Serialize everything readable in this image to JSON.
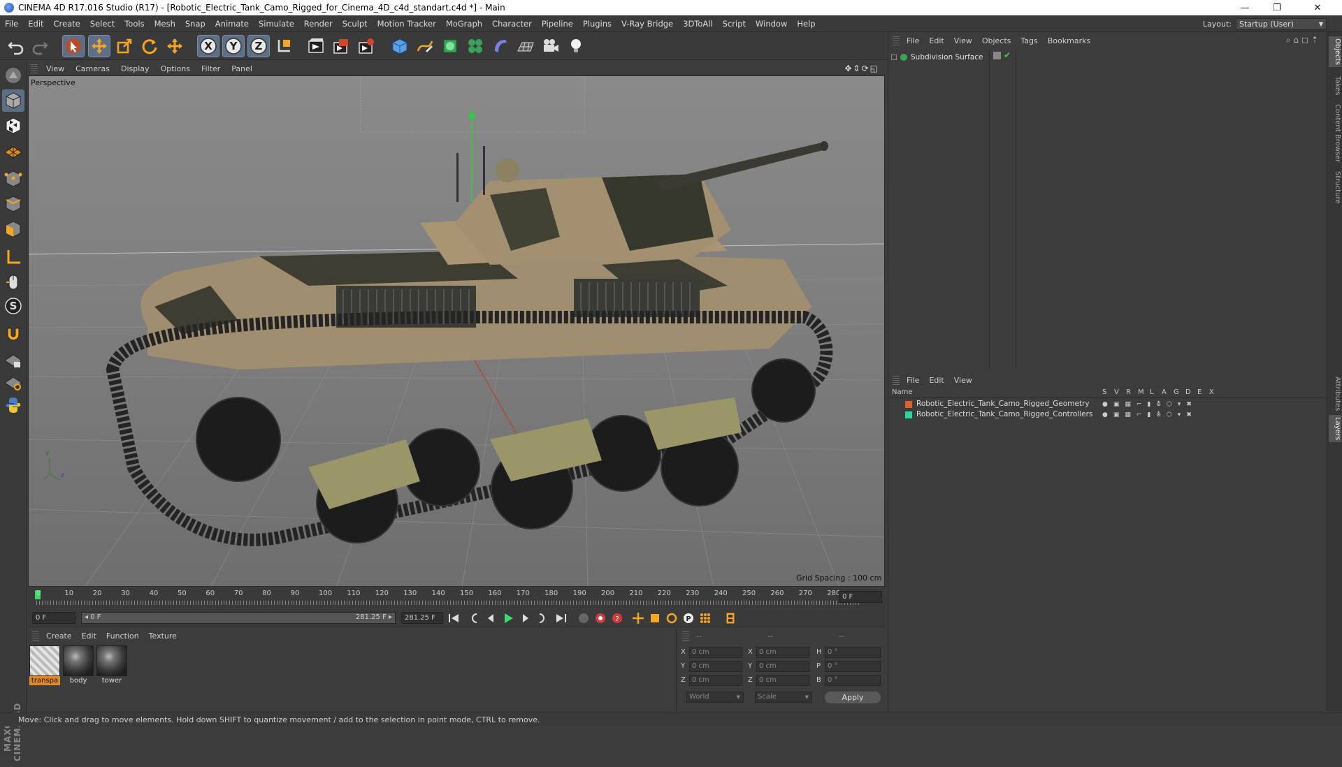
{
  "window": {
    "title": "CINEMA 4D R17.016 Studio (R17) - [Robotic_Electric_Tank_Camo_Rigged_for_Cinema_4D_c4d_standart.c4d *] - Main",
    "minimize": "—",
    "restore": "❐",
    "close": "✕"
  },
  "menubar": {
    "items": [
      "File",
      "Edit",
      "Create",
      "Select",
      "Tools",
      "Mesh",
      "Snap",
      "Animate",
      "Simulate",
      "Render",
      "Sculpt",
      "Motion Tracker",
      "MoGraph",
      "Character",
      "Pipeline",
      "Plugins",
      "V-Ray Bridge",
      "3DToAll",
      "Script",
      "Window",
      "Help"
    ],
    "layout_label": "Layout:",
    "layout_value": "Startup (User)"
  },
  "viewport": {
    "menu": [
      "View",
      "Cameras",
      "Display",
      "Options",
      "Filter",
      "Panel"
    ],
    "label": "Perspective",
    "grid_spacing": "Grid Spacing : 100 cm",
    "axis_y": "y",
    "axis_z": "z"
  },
  "timeline": {
    "ticks": [
      "0",
      "10",
      "20",
      "30",
      "40",
      "50",
      "60",
      "70",
      "80",
      "90",
      "100",
      "110",
      "120",
      "130",
      "140",
      "150",
      "160",
      "170",
      "180",
      "190",
      "200",
      "210",
      "220",
      "230",
      "240",
      "250",
      "260",
      "270",
      "280"
    ],
    "end_frame": "0 F",
    "range_start": "0 F",
    "range_inner_start": "0 F",
    "range_inner_end": "281.25 F",
    "range_end": "281.25 F"
  },
  "material_panel": {
    "menu": [
      "Create",
      "Edit",
      "Function",
      "Texture"
    ],
    "materials": [
      {
        "label": "transpa",
        "selected": true
      },
      {
        "label": "body",
        "selected": false
      },
      {
        "label": "tower",
        "selected": false
      }
    ]
  },
  "coord_panel": {
    "header": [
      "--",
      "--",
      "--"
    ],
    "rows": [
      {
        "l1": "X",
        "v1": "0 cm",
        "l2": "X",
        "v2": "0 cm",
        "l3": "H",
        "v3": "0 °"
      },
      {
        "l1": "Y",
        "v1": "0 cm",
        "l2": "Y",
        "v2": "0 cm",
        "l3": "P",
        "v3": "0 °"
      },
      {
        "l1": "Z",
        "v1": "0 cm",
        "l2": "Z",
        "v2": "0 cm",
        "l3": "B",
        "v3": "0 °"
      }
    ],
    "space": "World",
    "mode": "Scale",
    "apply": "Apply"
  },
  "object_panel": {
    "menu": [
      "File",
      "Edit",
      "View",
      "Objects",
      "Tags",
      "Bookmarks"
    ],
    "objects": [
      {
        "name": "Subdivision Surface"
      }
    ]
  },
  "layer_panel": {
    "menu": [
      "File",
      "Edit",
      "View"
    ],
    "columns": {
      "name": "Name",
      "flags": [
        "S",
        "V",
        "R",
        "M",
        "L",
        "A",
        "G",
        "D",
        "E",
        "X"
      ]
    },
    "layers": [
      {
        "name": "Robotic_Electric_Tank_Camo_Rigged_Geometry",
        "color": "#e0602a"
      },
      {
        "name": "Robotic_Electric_Tank_Camo_Rigged_Controllers",
        "color": "#2ad6a0"
      }
    ]
  },
  "right_tabs": [
    "Objects",
    "Takes",
    "Content Browser",
    "Structure",
    "Attributes",
    "Layers"
  ],
  "status": "Move: Click and drag to move elements. Hold down SHIFT to quantize movement / add to the selection in point mode, CTRL to remove.",
  "brand": "MAXON CINEMA 4D",
  "icons": [
    "undo-icon",
    "redo-icon",
    "live-select-icon",
    "move-icon",
    "scale-icon",
    "rotate-icon",
    "x-axis-icon",
    "y-axis-icon",
    "z-axis-icon",
    "coordinate-system-icon",
    "render-view-icon",
    "render-picture-icon",
    "render-settings-icon",
    "cube-icon",
    "spline-pen-icon",
    "subdivision-icon",
    "cloner-icon",
    "deformer-icon",
    "floor-icon",
    "camera-icon",
    "light-icon"
  ]
}
